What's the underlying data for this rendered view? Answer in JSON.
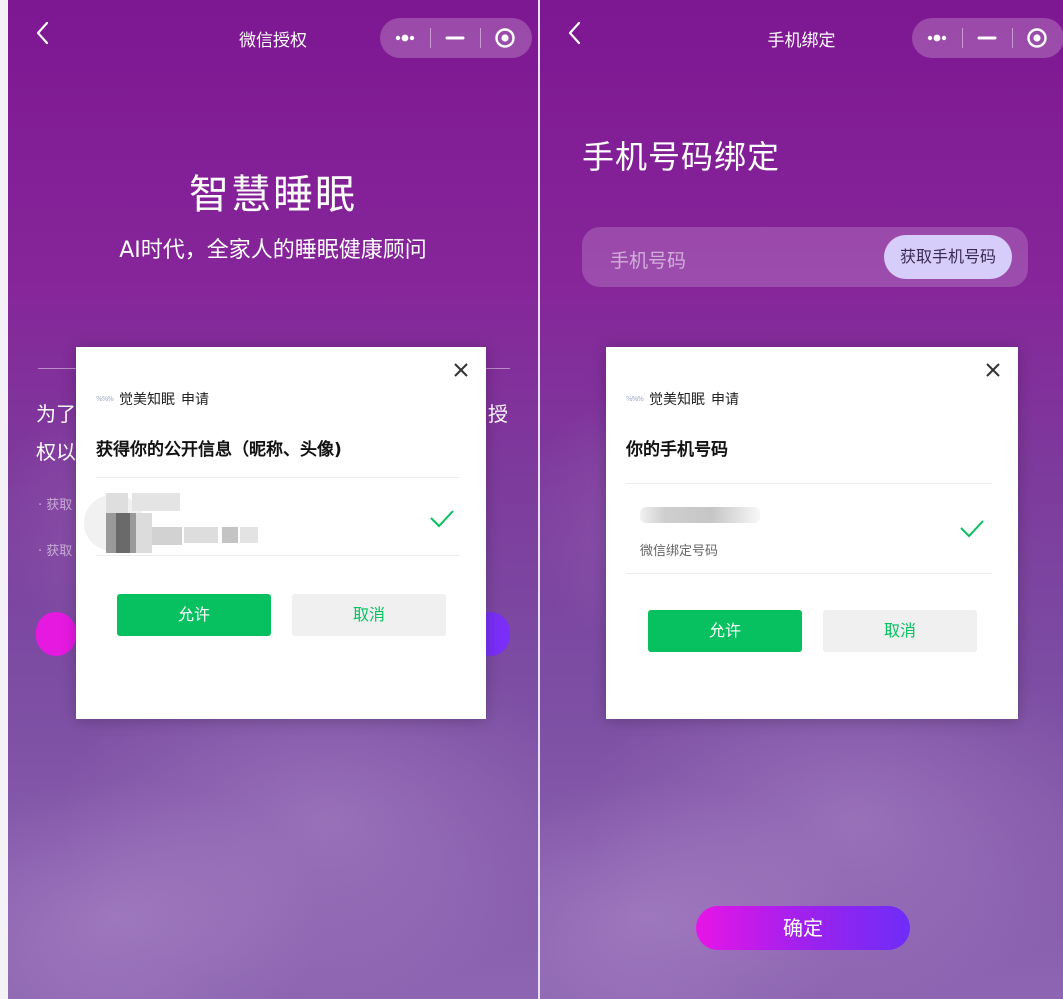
{
  "left_screen": {
    "nav_title": "微信授权",
    "hero_title": "智慧睡眠",
    "hero_subtitle": "AI时代，全家人的睡眠健康顾问",
    "bg_text_line1_left": "为了",
    "bg_text_line1_right": "授",
    "bg_text_line2_left": "权以",
    "bg_item1": "获取",
    "bg_item2": "获取",
    "dialog": {
      "app_logo_text": "%%%",
      "app_name": "觉美知眠",
      "request_word": "申请",
      "heading": "获得你的公开信息（昵称、头像)",
      "allow_label": "允许",
      "cancel_label": "取消"
    }
  },
  "right_screen": {
    "nav_title": "手机绑定",
    "heading": "手机号码绑定",
    "phone_placeholder": "手机号码",
    "get_phone_button": "获取手机号码",
    "confirm_button": "确定",
    "dialog": {
      "app_logo_text": "%%%",
      "app_name": "觉美知眠",
      "request_word": "申请",
      "heading": "你的手机号码",
      "phone_note": "微信绑定号码",
      "allow_label": "允许",
      "cancel_label": "取消"
    }
  },
  "colors": {
    "allow_green": "#07c160",
    "purple_bg": "#7e1792",
    "button_gradient_start": "#e615e6",
    "button_gradient_end": "#6f2cf8",
    "get_phone_bg": "#d7cdfa"
  },
  "icons": {
    "back": "chevron-left-icon",
    "more": "more-dots-icon",
    "minimize": "minimize-icon",
    "close_capsule": "target-circle-icon",
    "dialog_close": "close-icon",
    "check": "checkmark-icon"
  }
}
